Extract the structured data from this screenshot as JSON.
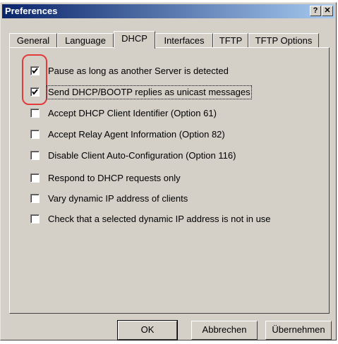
{
  "window": {
    "title": "Preferences"
  },
  "tabs": [
    {
      "label": "General"
    },
    {
      "label": "Language"
    },
    {
      "label": "DHCP",
      "active": true
    },
    {
      "label": "Interfaces"
    },
    {
      "label": "TFTP"
    },
    {
      "label": "TFTP Options"
    }
  ],
  "options": [
    {
      "label": "Pause as long as another Server is detected",
      "checked": true
    },
    {
      "label": "Send DHCP/BOOTP replies as unicast messages",
      "checked": true
    },
    {
      "label": "Accept DHCP Client Identifier (Option 61)",
      "checked": false
    },
    {
      "label": "Accept Relay Agent Information (Option 82)",
      "checked": false
    },
    {
      "label": "Disable Client Auto-Configuration (Option 116)",
      "checked": false
    },
    {
      "label": "Respond to DHCP requests only",
      "checked": false
    },
    {
      "label": "Vary dynamic IP address of clients",
      "checked": false
    },
    {
      "label": "Check that a selected dynamic IP address is not in use",
      "checked": false
    }
  ],
  "buttons": {
    "ok": "OK",
    "cancel": "Abbrechen",
    "apply": "Übernehmen"
  },
  "colors": {
    "face": "#d4d0c8",
    "title_start": "#0a246a",
    "title_end": "#a6caf0",
    "highlight_ring": "#e23b3b"
  }
}
